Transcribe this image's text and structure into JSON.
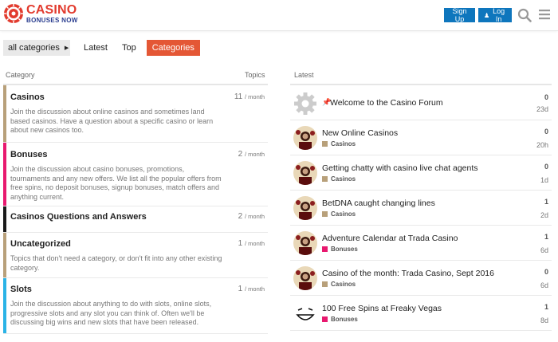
{
  "brand": {
    "logo_main": "CASINO",
    "logo_sub": "BONUSES NOW"
  },
  "header": {
    "signup_label": "Sign Up",
    "login_label": "Log In"
  },
  "nav": {
    "dropdown_label": "all categories",
    "tabs": [
      "Latest",
      "Top",
      "Categories"
    ],
    "active_tab": "Categories"
  },
  "colors": {
    "accent": "#e45735",
    "button": "#0e76bd",
    "casinos": "#b8a07a",
    "bonuses": "#e8196f",
    "qa": "#1a1a1a",
    "uncategorized": "#b8a07a",
    "slots": "#2ab3e6"
  },
  "columns": {
    "category": "Category",
    "topics": "Topics",
    "latest": "Latest"
  },
  "per_month": "/ month",
  "categories": [
    {
      "name": "Casinos",
      "count": "11",
      "description": "Join the discussion about online casinos and sometimes land based casinos. Have a question about a specific casino or learn about new casinos too."
    },
    {
      "name": "Bonuses",
      "count": "2",
      "description": "Join the discussion about casino bonuses, promotions, tournaments and any new offers. We list all the popular offers from free spins, no deposit bonuses, signup bonuses, match offers and anything current."
    },
    {
      "name": "Casinos Questions and Answers",
      "count": "2",
      "description": ""
    },
    {
      "name": "Uncategorized",
      "count": "1",
      "description": "Topics that don't need a category, or don't fit into any other existing category."
    },
    {
      "name": "Slots",
      "count": "1",
      "description": "Join the discussion about anything to do with slots, online slots, progressive slots and any slot you can think of. Often we'll be discussing big wins and new slots that have been released."
    }
  ],
  "topics": [
    {
      "title": "Welcome to the Casino Forum",
      "category": "",
      "replies": "0",
      "age": "23d",
      "pinned": true,
      "avatar": "gear-icon"
    },
    {
      "title": "New Online Casinos",
      "category": "Casinos",
      "replies": "0",
      "age": "20h",
      "avatar": "dealer"
    },
    {
      "title": "Getting chatty with casino live chat agents",
      "category": "Casinos",
      "replies": "0",
      "age": "1d",
      "avatar": "dealer"
    },
    {
      "title": "BetDNA caught changing lines",
      "category": "Casinos",
      "replies": "1",
      "age": "2d",
      "avatar": "dealer"
    },
    {
      "title": "Adventure Calendar at Trada Casino",
      "category": "Bonuses",
      "replies": "1",
      "age": "6d",
      "avatar": "dealer"
    },
    {
      "title": "Casino of the month: Trada Casino, Sept 2016",
      "category": "Casinos",
      "replies": "0",
      "age": "6d",
      "avatar": "dealer"
    },
    {
      "title": "100 Free Spins at Freaky Vegas",
      "category": "Bonuses",
      "replies": "1",
      "age": "8d",
      "avatar": "smiley"
    }
  ]
}
